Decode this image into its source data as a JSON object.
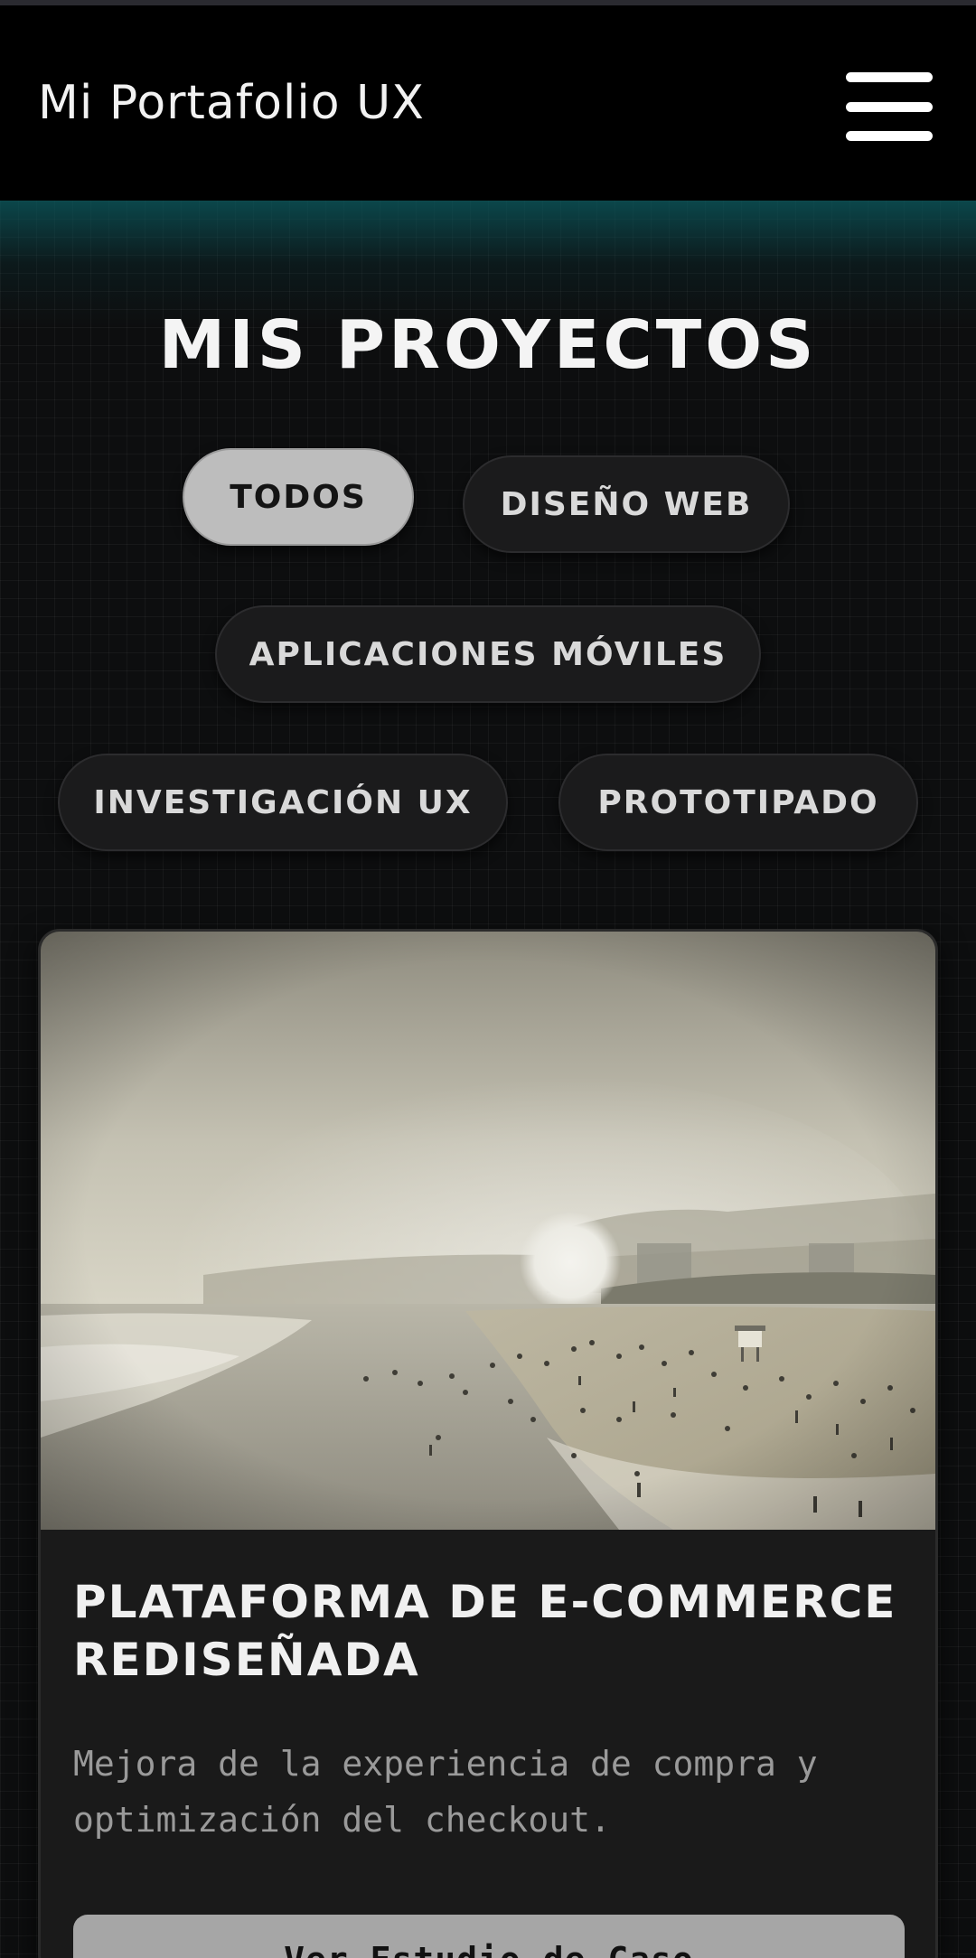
{
  "header": {
    "brand": "Mi Portafolio UX",
    "menu_icon": "hamburger-menu-icon"
  },
  "main": {
    "title": "MIS PROYECTOS",
    "filters": [
      {
        "label": "TODOS",
        "active": true
      },
      {
        "label": "DISEÑO WEB",
        "active": false
      },
      {
        "label": "APLICACIONES MÓVILES",
        "active": false
      },
      {
        "label": "INVESTIGACIÓN UX",
        "active": false
      },
      {
        "label": "PROTOTIPADO",
        "active": false
      }
    ]
  },
  "project_card": {
    "image": "beach-photo",
    "title_line1": "PLATAFORMA DE E-COMMERCE",
    "title_line2": "REDISEÑADA",
    "description_line1": "Mejora de la experiencia de compra y",
    "description_line2": "optimización del checkout.",
    "button_label": "Ver Estudio de Caso"
  },
  "colors": {
    "header_bg": "#000000",
    "page_bg": "#0d0e0f",
    "accent_glow": "#0a5a5f",
    "chip_active": "#bdbdbd",
    "chip_inactive": "#1b1b1c",
    "card_bg": "#1a1a1a"
  }
}
